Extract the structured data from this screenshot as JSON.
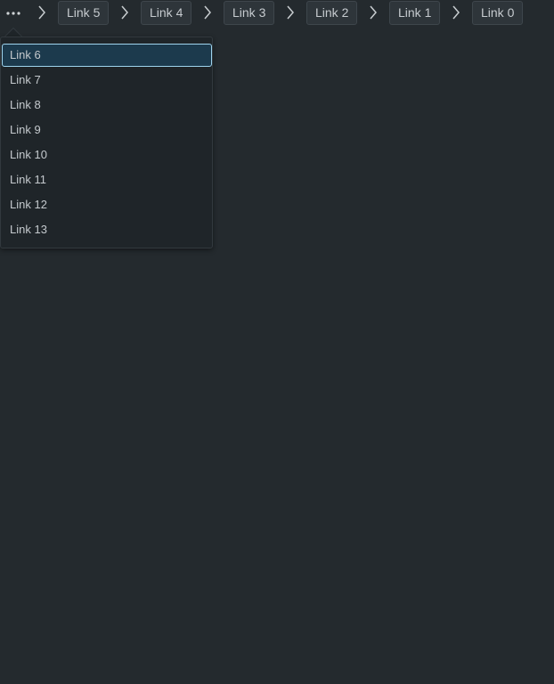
{
  "breadcrumb": {
    "overflow_icon": "ellipsis-icon",
    "separator_icon": "chevron-right-icon",
    "items": [
      {
        "label": "Link 5"
      },
      {
        "label": "Link 4"
      },
      {
        "label": "Link 3"
      },
      {
        "label": "Link 2"
      },
      {
        "label": "Link 1"
      },
      {
        "label": "Link 0"
      }
    ]
  },
  "overflow_menu": {
    "focused_index": 0,
    "items": [
      {
        "label": "Link 6"
      },
      {
        "label": "Link 7"
      },
      {
        "label": "Link 8"
      },
      {
        "label": "Link 9"
      },
      {
        "label": "Link 10"
      },
      {
        "label": "Link 11"
      },
      {
        "label": "Link 12"
      },
      {
        "label": "Link 13"
      }
    ]
  },
  "colors": {
    "background": "#242a2e",
    "focus_ring": "#9fd4ee",
    "focus_fill": "#1c3a4d"
  }
}
